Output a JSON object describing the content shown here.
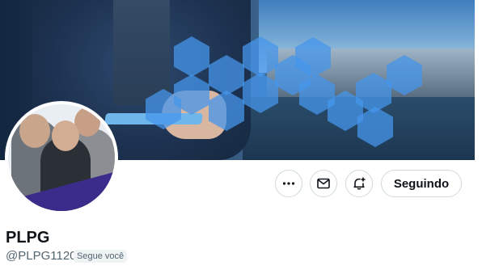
{
  "profile": {
    "display_name": "PLPG",
    "handle": "@PLPG1120",
    "follows_you_badge": "Segue você"
  },
  "actions": {
    "more_icon": "more-horizontal-icon",
    "message_icon": "mail-icon",
    "notify_icon": "bell-plus-icon",
    "following_label": "Seguindo"
  },
  "colors": {
    "text_primary": "#0f1419",
    "text_secondary": "#536471",
    "border": "#cfd9de",
    "badge_bg": "#eff3f4"
  }
}
